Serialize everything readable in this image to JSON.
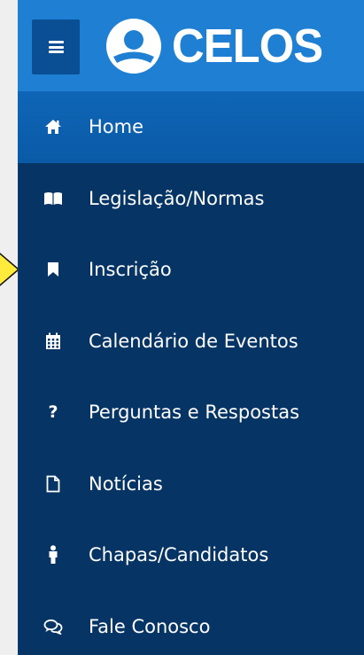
{
  "brand": {
    "name": "CELOS"
  },
  "colors": {
    "header_blue": "#1f80d3",
    "sidebar_navy": "#063565",
    "active_blue": "#0f66b6",
    "pointer_yellow": "#ffeb3b"
  },
  "header": {
    "menu_icon": "hamburger-icon"
  },
  "nav": {
    "items": [
      {
        "label": "Home",
        "icon": "home-icon",
        "active": true
      },
      {
        "label": "Legislação/Normas",
        "icon": "book-icon",
        "active": false
      },
      {
        "label": "Inscrição",
        "icon": "bookmark-icon",
        "active": false
      },
      {
        "label": "Calendário de Eventos",
        "icon": "calendar-icon",
        "active": false
      },
      {
        "label": "Perguntas e Respostas",
        "icon": "question-icon",
        "active": false
      },
      {
        "label": "Notícias",
        "icon": "document-icon",
        "active": false
      },
      {
        "label": "Chapas/Candidatos",
        "icon": "person-icon",
        "active": false
      },
      {
        "label": "Fale Conosco",
        "icon": "chat-icon",
        "active": false
      }
    ]
  }
}
